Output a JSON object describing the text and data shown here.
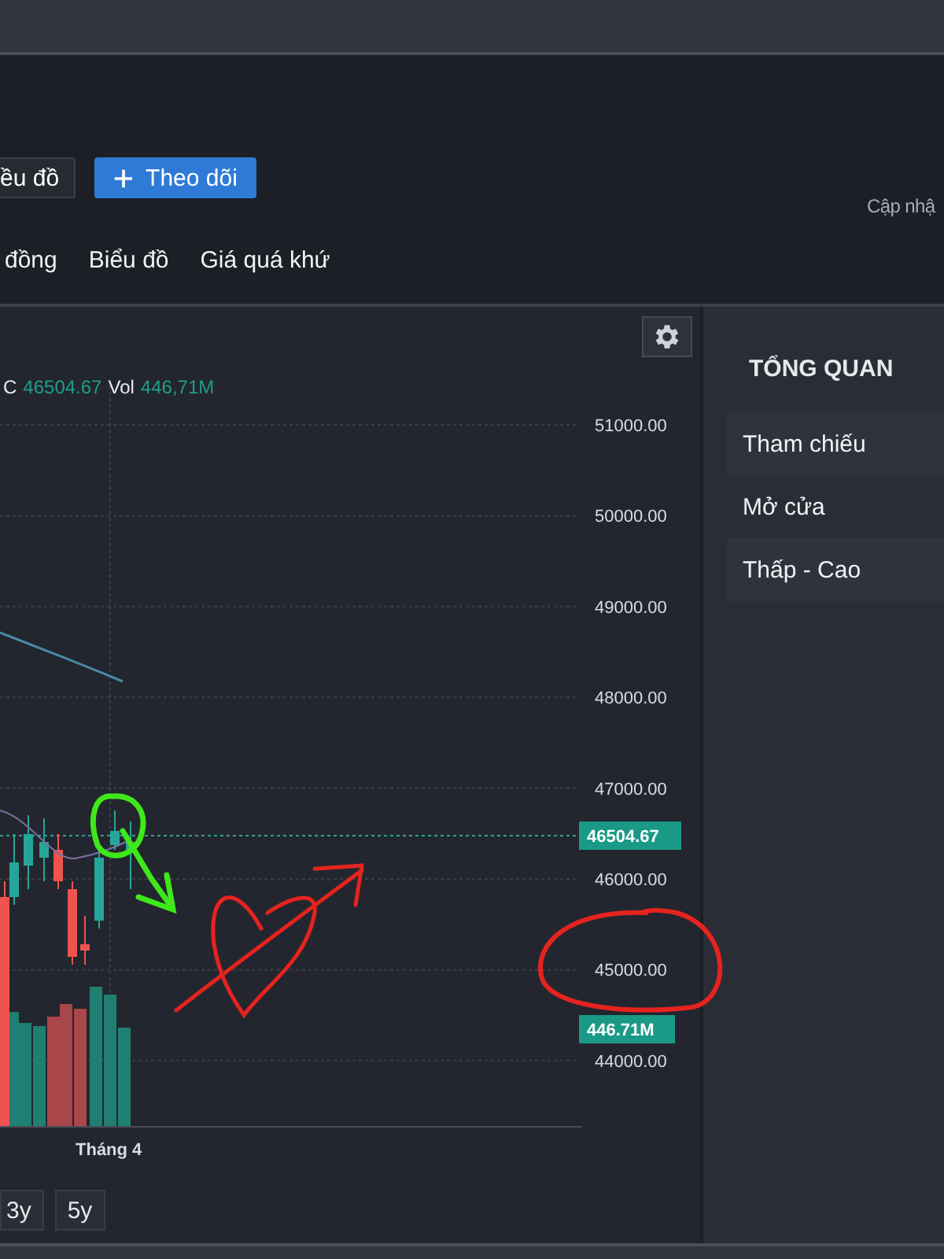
{
  "top_buttons": [
    {
      "label": "ều đồ",
      "kind": "outline"
    },
    {
      "label": "Theo dõi",
      "kind": "primary"
    }
  ],
  "update_text": "Cập nhậ",
  "tabs": [
    {
      "label": "đồng"
    },
    {
      "label": "Biểu đồ"
    },
    {
      "label": "Giá quá khứ"
    }
  ],
  "legend": {
    "close_label": "C",
    "close": "46504.67",
    "vol_label": "Vol",
    "vol": "446,71M"
  },
  "chart": {
    "y_labels": [
      "51000.00",
      "50000.00",
      "49000.00",
      "48000.00",
      "47000.00",
      "46000.00",
      "45000.00",
      "44000.00"
    ],
    "price_tag": "46504.67",
    "volume_tag": "446.71M",
    "x_label": "Tháng 4"
  },
  "range_buttons": [
    "3y",
    "5y"
  ],
  "overview": {
    "title": "TỔNG QUAN",
    "rows": [
      "Tham chiếu",
      "Mở cửa",
      "Thấp - Cao"
    ]
  }
}
